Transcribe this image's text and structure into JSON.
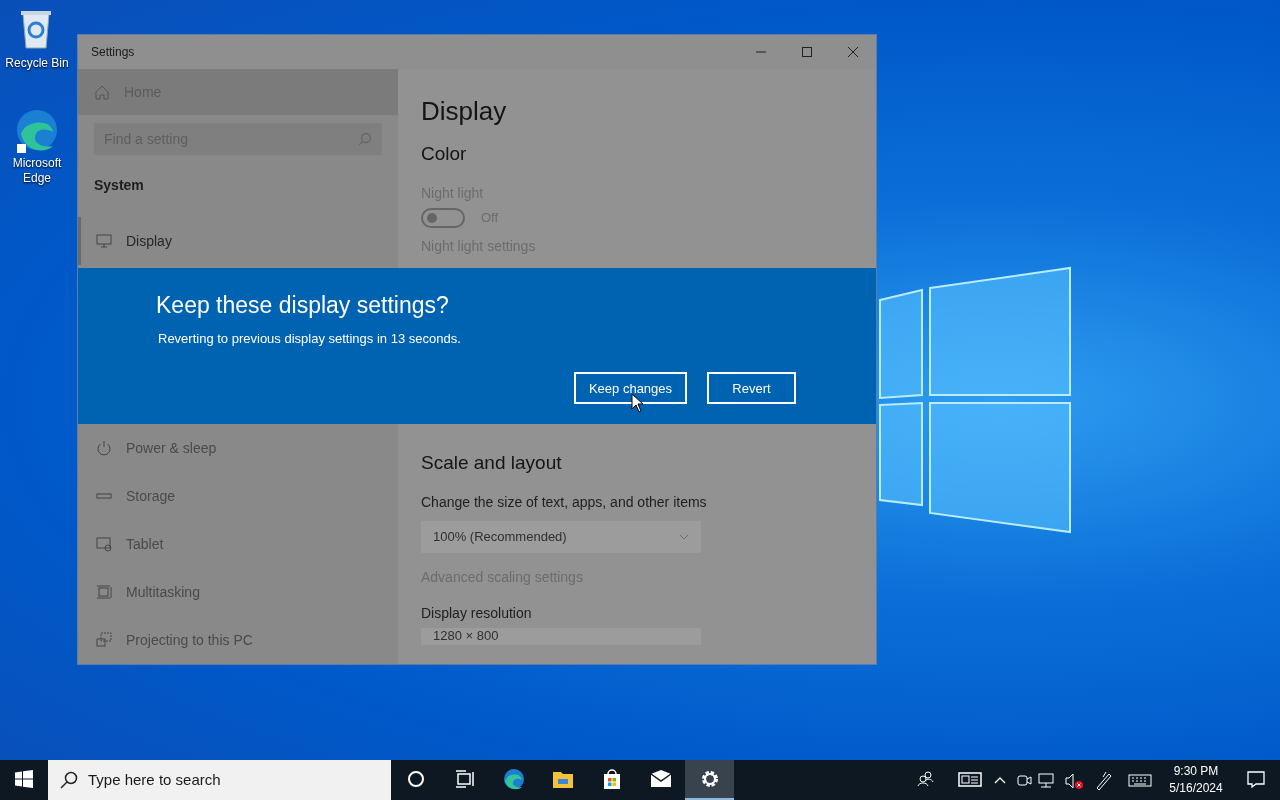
{
  "desktop_icons": [
    {
      "label": "Recycle Bin",
      "kind": "recycle"
    },
    {
      "label": "Microsoft Edge",
      "kind": "edge"
    }
  ],
  "window": {
    "title": "Settings"
  },
  "sidebar": {
    "home": "Home",
    "search": {
      "placeholder": "Find a setting"
    },
    "section": "System",
    "items_top": [
      {
        "label": "Display",
        "kind": "display",
        "selected": true
      }
    ],
    "items_bottom": [
      {
        "label": "Power & sleep",
        "kind": "power",
        "selected": false
      },
      {
        "label": "Storage",
        "kind": "storage",
        "selected": false
      },
      {
        "label": "Tablet",
        "kind": "tablet",
        "selected": false
      },
      {
        "label": "Multitasking",
        "kind": "multitask",
        "selected": false
      },
      {
        "label": "Projecting to this PC",
        "kind": "project",
        "selected": false
      }
    ]
  },
  "content": {
    "title": "Display",
    "color_heading": "Color",
    "night_light": {
      "label": "Night light",
      "on": false,
      "state_text": "Off"
    },
    "night_light_link": "Night light settings",
    "scale_heading": "Scale and layout",
    "scale_label": "Change the size of text, apps, and other items",
    "scale_value": "100% (Recommended)",
    "advanced_link": "Advanced scaling settings",
    "resolution_label": "Display resolution",
    "resolution_value": "1280 × 800"
  },
  "dialog": {
    "title": "Keep these display settings?",
    "message": "Reverting to previous display settings in 13 seconds.",
    "buttons": [
      {
        "label": "Keep changes"
      },
      {
        "label": "Revert"
      }
    ]
  },
  "taskbar": {
    "search": {
      "placeholder": "Type here to search"
    },
    "apps": [
      {
        "kind": "cortana",
        "selected": false
      },
      {
        "kind": "taskview",
        "selected": false
      },
      {
        "kind": "edge",
        "selected": false
      },
      {
        "kind": "explorer",
        "selected": false
      },
      {
        "kind": "store",
        "selected": false
      },
      {
        "kind": "mail",
        "selected": false
      },
      {
        "kind": "settings",
        "selected": true
      }
    ],
    "clock": {
      "time": "9:30 PM",
      "date": "5/16/2024"
    }
  }
}
